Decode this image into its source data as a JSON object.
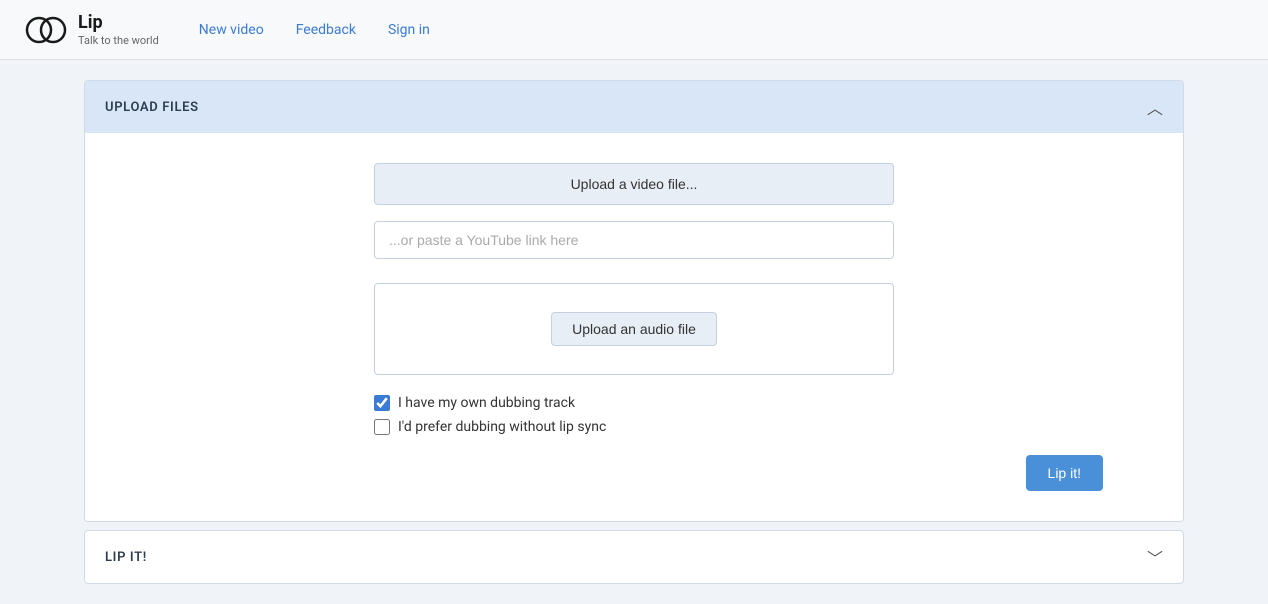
{
  "header": {
    "logo_title": "Lip",
    "logo_subtitle": "Talk to the world",
    "nav": {
      "new_video": "New video",
      "feedback": "Feedback",
      "sign_in": "Sign in"
    }
  },
  "upload_section": {
    "title": "UPLOAD FILES",
    "chevron_up": "︿",
    "upload_video_label": "Upload a video file...",
    "youtube_placeholder": "...or paste a YouTube link here",
    "audio_area": {
      "upload_audio_label": "Upload an audio file"
    },
    "checkbox_own_dubbing": {
      "label": "I have my own dubbing track",
      "checked": true
    },
    "checkbox_no_lip_sync": {
      "label": "I'd prefer dubbing without lip sync",
      "checked": false
    },
    "lip_it_button": "Lip it!"
  },
  "lip_it_section": {
    "title": "LIP IT!",
    "chevron_down": "﹀"
  }
}
